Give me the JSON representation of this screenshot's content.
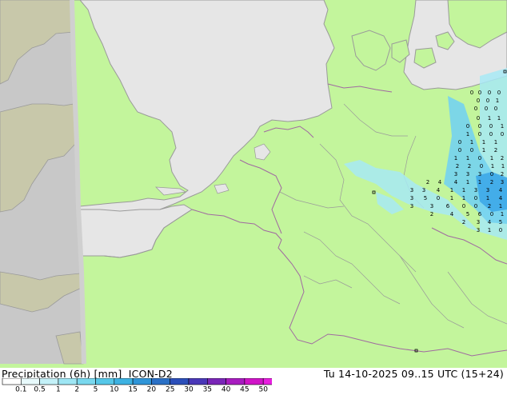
{
  "header": {
    "product_label": "Precipitation (6h) [mm]",
    "model": "ICON-D2",
    "valid_time": "Tu 14-10-2025 09..15 UTC (15+24)"
  },
  "colors": {
    "land": "#c3f59c",
    "sea": "#e6e6e6",
    "outside_domain_land": "#c8c8aa",
    "outside_domain_sea": "#c8c8c8",
    "coast": "#9a9a9a",
    "border": "#a06aa0",
    "precip_light": "#a7e9f5",
    "precip_mid": "#74d3ef",
    "precip_heavy": "#3aa6e8"
  },
  "legend": {
    "tick_labels": [
      "0.1",
      "0.5",
      "1",
      "2",
      "5",
      "10",
      "15",
      "20",
      "25",
      "30",
      "35",
      "40",
      "45",
      "50"
    ],
    "colors": [
      "#ffffff",
      "#e8fafc",
      "#c4f1f8",
      "#9ee6f4",
      "#79d8ee",
      "#55c7e8",
      "#3db2e2",
      "#2f95d8",
      "#2a70c6",
      "#2c4fba",
      "#4a38b8",
      "#7a26b8",
      "#a81cc0",
      "#d014c8",
      "#e81ee0"
    ]
  },
  "station_values": [
    "0",
    "0",
    "0",
    "0",
    "0",
    "0",
    "1",
    "0",
    "0",
    "0",
    "0",
    "1",
    "1",
    "0",
    "0",
    "0",
    "1",
    "1",
    "0",
    "0",
    "0",
    "0",
    "1",
    "1",
    "1",
    "0",
    "0",
    "1",
    "2",
    "1",
    "1",
    "0",
    "1",
    "2",
    "2",
    "2",
    "0",
    "1",
    "1",
    "3",
    "3",
    "3",
    "0",
    "2",
    "2",
    "4",
    "4",
    "1",
    "1",
    "2",
    "3",
    "3",
    "3",
    "4",
    "1",
    "1",
    "3",
    "3",
    "4",
    "3",
    "5",
    "0",
    "1",
    "1",
    "0",
    "1",
    "4",
    "3",
    "3",
    "6",
    "0",
    "0",
    "2",
    "1",
    "2",
    "4",
    "5",
    "6",
    "0",
    "1",
    "2",
    "3",
    "4",
    "5",
    "3",
    "1",
    "0",
    "1",
    "1",
    "3",
    "4",
    "5",
    "1",
    "0",
    "1",
    "2",
    "2",
    "4",
    "3",
    "0",
    "1",
    "1",
    "1",
    "2",
    "3",
    "1",
    "0",
    "1",
    "1",
    "2",
    "1",
    "0",
    "1",
    "0",
    "1",
    "1",
    "1"
  ]
}
